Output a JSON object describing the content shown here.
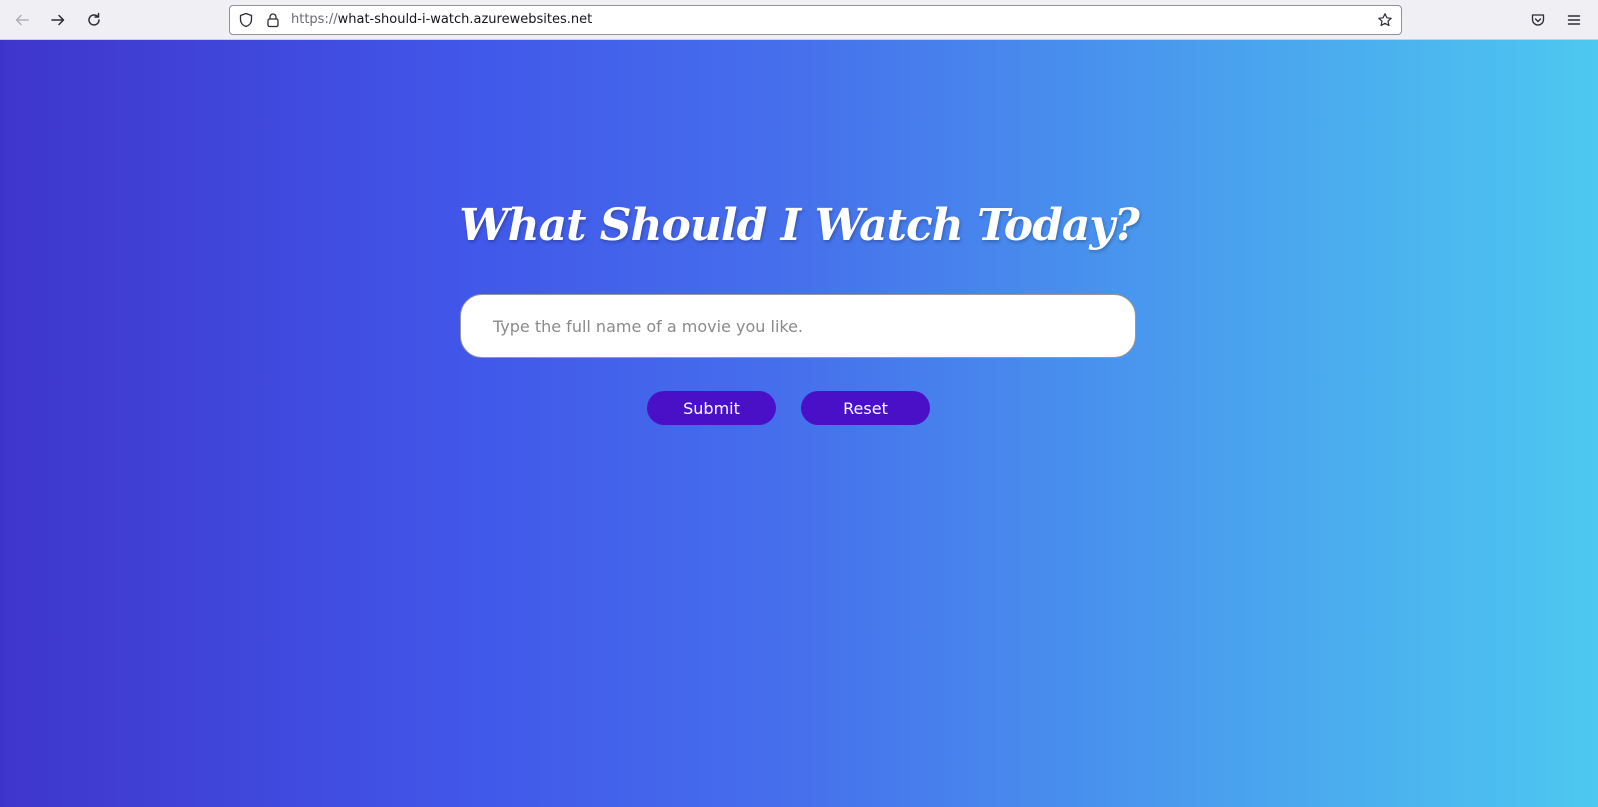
{
  "browser": {
    "url_protocol": "https://",
    "url_host": "what-should-i-watch.azurewebsites.net",
    "icons": [
      "back-arrow-icon",
      "forward-arrow-icon",
      "reload-icon",
      "shield-icon",
      "lock-icon",
      "star-icon",
      "pocket-icon",
      "menu-icon"
    ]
  },
  "page": {
    "title": "What Should I Watch Today?",
    "search": {
      "placeholder": "Type the full name of a movie you like.",
      "value": ""
    },
    "buttons": {
      "submit_label": "Submit",
      "reset_label": "Reset"
    },
    "colors": {
      "gradient_left": "#3f35cc",
      "gradient_right": "#4dc8f0",
      "button_bg": "#4a10c8",
      "title_color": "#ffffff"
    }
  }
}
